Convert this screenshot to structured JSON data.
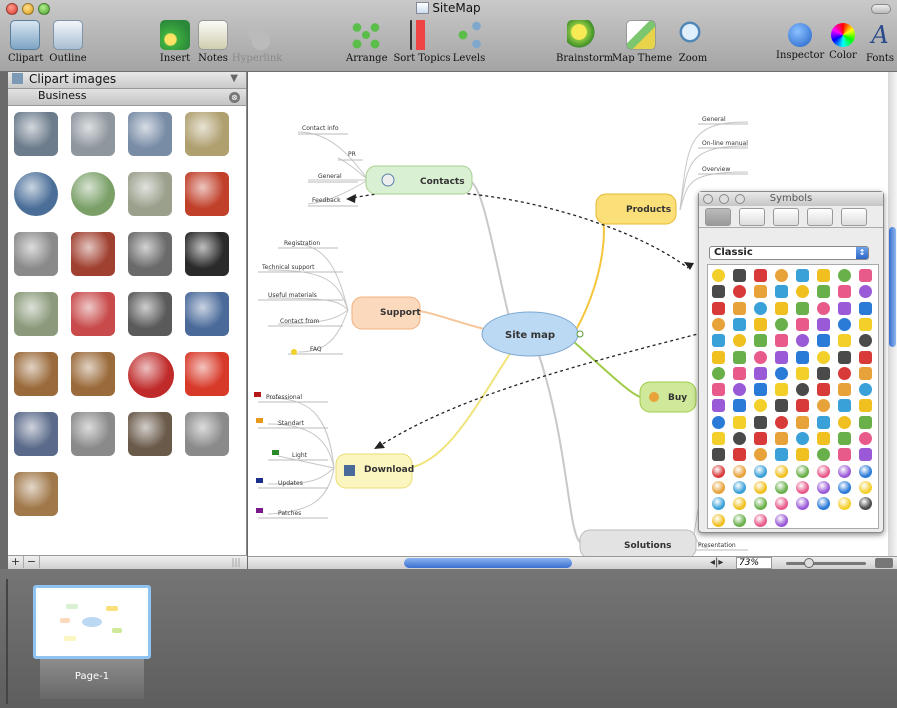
{
  "window": {
    "title": "SiteMap"
  },
  "toolbar": {
    "clipart": "Clipart",
    "outline": "Outline",
    "insert": "Insert",
    "notes": "Notes",
    "hyperlink": "Hyperlink",
    "arrange": "Arrange",
    "sort_topics": "Sort Topics",
    "levels": "Levels",
    "brainstorm": "Brainstorm",
    "map_theme": "Map Theme",
    "zoom": "Zoom",
    "inspector": "Inspector",
    "color": "Color",
    "fonts": "Fonts"
  },
  "sidebar": {
    "title": "Clipart images",
    "category": "Business",
    "add_label": "+",
    "remove_label": "−"
  },
  "mindmap": {
    "central": "Site map",
    "topics": {
      "contacts": {
        "label": "Contacts",
        "subtopics": [
          "Contact info",
          "PR",
          "General",
          "Feedback"
        ]
      },
      "support": {
        "label": "Support",
        "subtopics": [
          "Registration",
          "Technical support",
          "Useful materials",
          "Contact from",
          "FAQ"
        ]
      },
      "download": {
        "label": "Download",
        "subtopics": [
          "Professional",
          "Standart",
          "Light",
          "Updates",
          "Patches"
        ]
      },
      "products": {
        "label": "Products",
        "subtopics": [
          "General",
          "On-line manual",
          "Overview"
        ]
      },
      "buy": {
        "label": "Buy"
      },
      "solutions": {
        "label": "Solutions",
        "subtopics": [
          "Presentation"
        ]
      }
    }
  },
  "canvas_controls": {
    "zoom": "73%"
  },
  "symbols_panel": {
    "title": "Symbols",
    "set": "Classic"
  },
  "pages": {
    "page1": "Page-1"
  },
  "colors": {
    "accent_blue": "#3a6fcf",
    "central_node": "#bcd9f3",
    "contacts_node": "#d9f0d2",
    "support_node": "#fbd9bd",
    "download_node": "#fbf6c0",
    "products_node": "#fbe07a",
    "buy_node": "#cfe89a"
  }
}
